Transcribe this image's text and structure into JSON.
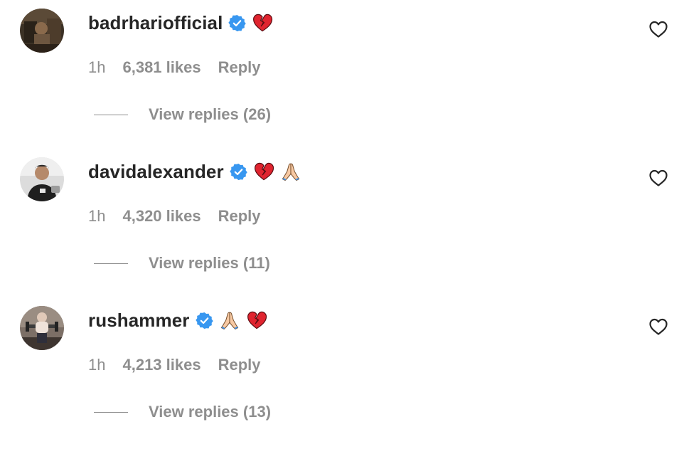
{
  "comments": [
    {
      "username": "badrhariofficial",
      "verified": true,
      "emojis": [
        "broken-heart"
      ],
      "time": "1h",
      "likes": "6,381 likes",
      "reply_label": "Reply",
      "view_replies_label": "View replies (26)",
      "avatar": "profile-photo"
    },
    {
      "username": "davidalexander",
      "verified": true,
      "emojis": [
        "broken-heart",
        "folded-hands"
      ],
      "time": "1h",
      "likes": "4,320 likes",
      "reply_label": "Reply",
      "view_replies_label": "View replies (11)",
      "avatar": "profile-photo"
    },
    {
      "username": "rushammer",
      "verified": true,
      "emojis": [
        "folded-hands",
        "broken-heart"
      ],
      "time": "1h",
      "likes": "4,213 likes",
      "reply_label": "Reply",
      "view_replies_label": "View replies (13)",
      "avatar": "profile-photo"
    }
  ],
  "colors": {
    "text_primary": "#262626",
    "text_secondary": "#8e8e8e",
    "verified_blue": "#3897f0",
    "broken_heart_red": "#e0242f",
    "background": "#ffffff"
  },
  "icons": {
    "like": "heart-outline-icon",
    "verified": "verified-badge-icon"
  }
}
